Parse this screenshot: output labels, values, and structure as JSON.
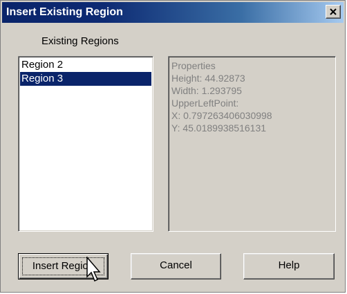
{
  "window": {
    "title": "Insert Existing Region",
    "close_icon": "close-icon"
  },
  "regions": {
    "label": "Existing Regions",
    "items": [
      {
        "label": "Region 2",
        "selected": false
      },
      {
        "label": "Region 3",
        "selected": true
      }
    ]
  },
  "properties": {
    "lines": [
      "Properties",
      "Height: 44.92873",
      "Width: 1.293795",
      "UpperLeftPoint:",
      "X: 0.797263406030998",
      "Y: 45.0189938516131"
    ]
  },
  "buttons": {
    "insert": "Insert Region",
    "cancel": "Cancel",
    "help": "Help"
  },
  "colors": {
    "dialog_bg": "#d4d0c8",
    "selection": "#0a246a",
    "title_start": "#0a246a",
    "title_end": "#a6caf0",
    "disabled_text": "#808080"
  }
}
